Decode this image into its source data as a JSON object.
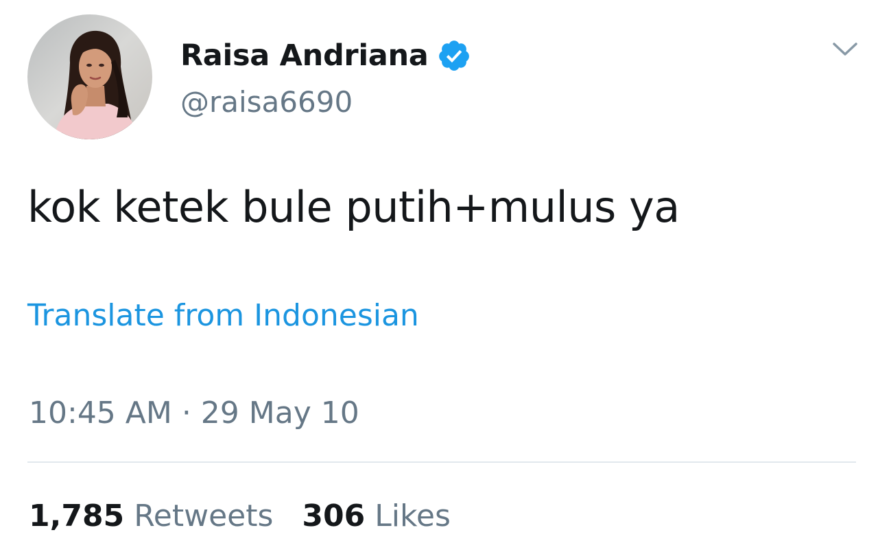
{
  "user": {
    "display_name": "Raisa Andriana",
    "handle": "@raisa6690",
    "verified": true,
    "avatar_icon": "profile-photo"
  },
  "tweet": {
    "text": "kok ketek bule putih+mulus ya",
    "translate_label": "Translate from Indonesian",
    "timestamp": "10:45 AM · 29 May 10"
  },
  "stats": {
    "retweets_count": "1,785",
    "retweets_label": "Retweets",
    "likes_count": "306",
    "likes_label": "Likes"
  },
  "icons": {
    "verified": "verified-badge-icon",
    "menu": "chevron-down-icon"
  },
  "colors": {
    "text_primary": "#14171a",
    "text_secondary": "#657786",
    "link": "#1b95e0",
    "verified": "#1da1f2",
    "divider": "#e1e8ed"
  }
}
